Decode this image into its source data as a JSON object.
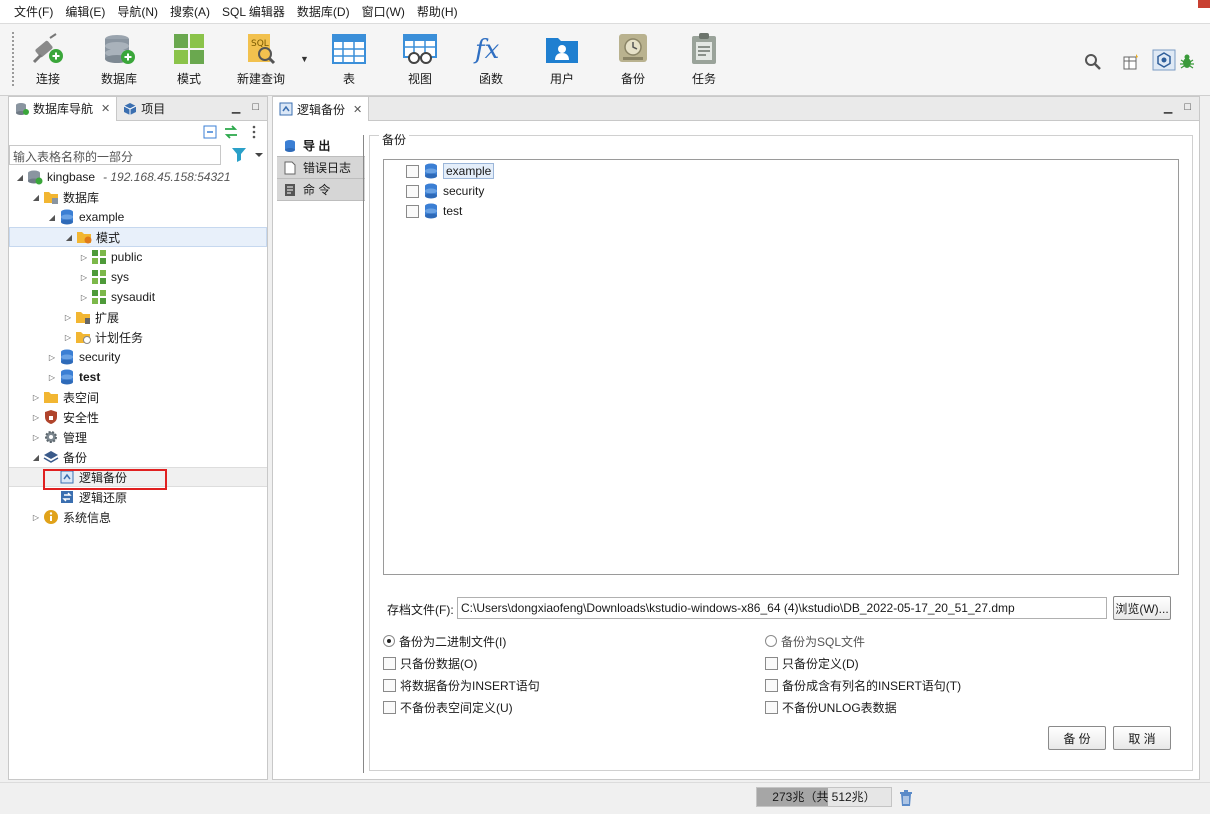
{
  "menu": [
    "文件(F)",
    "编辑(E)",
    "导航(N)",
    "搜索(A)",
    "SQL 编辑器",
    "数据库(D)",
    "窗口(W)",
    "帮助(H)"
  ],
  "toolbar": {
    "connect": "连接",
    "database": "数据库",
    "schema": "模式",
    "new_query": "新建查询",
    "table": "表",
    "view": "视图",
    "function": "函数",
    "user": "用户",
    "backup": "备份",
    "task": "任务"
  },
  "left_panel": {
    "tab_navigator": "数据库导航",
    "tab_project": "项目",
    "filter_placeholder": "输入表格名称的一部分",
    "tree": {
      "root": "kingbase",
      "root_host": "- 192.168.45.158:54321",
      "databases": "数据库",
      "example": "example",
      "schemas": "模式",
      "public": "public",
      "sys": "sys",
      "sysaudit": "sysaudit",
      "extensions": "扩展",
      "scheduled_tasks": "计划任务",
      "security_db": "security",
      "test_db": "test",
      "tablespaces": "表空间",
      "security": "安全性",
      "management": "管理",
      "backup": "备份",
      "logical_backup": "逻辑备份",
      "logical_restore": "逻辑还原",
      "system_info": "系统信息"
    }
  },
  "editor": {
    "tab_title": "逻辑备份",
    "side_tabs": [
      "导 出",
      "错误日志",
      "命 令"
    ],
    "group_title": "备份",
    "databases": [
      "example",
      "security",
      "test"
    ],
    "file_label": "存档文件(F):",
    "file_path": "C:\\Users\\dongxiaofeng\\Downloads\\kstudio-windows-x86_64 (4)\\kstudio\\DB_2022-05-17_20_51_27.dmp",
    "browse_button": "浏览(W)...",
    "options": {
      "binary": "备份为二进制文件(I)",
      "sql": "备份为SQL文件",
      "data_only": "只备份数据(O)",
      "schema_only": "只备份定义(D)",
      "insert": "将数据备份为INSERT语句",
      "insert_columns": "备份成含有列名的INSERT语句(T)",
      "no_tablespace": "不备份表空间定义(U)",
      "no_unlog": "不备份UNLOG表数据"
    },
    "backup_button": "备 份",
    "cancel_button": "取 消"
  },
  "status": {
    "memory": "273兆（共 512兆）",
    "memory_fraction": 0.533
  },
  "colors": {
    "accent": "#3b7fd4",
    "highlight": "#e02020"
  }
}
